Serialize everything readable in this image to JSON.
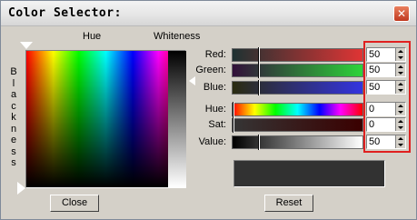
{
  "window": {
    "title": "Color Selector:",
    "close_glyph": "✕"
  },
  "headers": {
    "hue": "Hue",
    "whiteness": "Whiteness",
    "blackness": "Blackness"
  },
  "sliders": [
    {
      "label": "Red:",
      "value": "50",
      "level": 0.196,
      "colors": [
        "#1e3232",
        "#e03434"
      ]
    },
    {
      "label": "Green:",
      "value": "50",
      "level": 0.196,
      "colors": [
        "#32103a",
        "#2ed43a"
      ]
    },
    {
      "label": "Blue:",
      "value": "50",
      "level": 0.196,
      "colors": [
        "#2a2c10",
        "#3434e0"
      ]
    },
    {
      "label": "Hue:",
      "value": "0",
      "level": 0.0,
      "colors": [
        "spectrum"
      ]
    },
    {
      "label": "Sat:",
      "value": "0",
      "level": 0.0,
      "colors": [
        "#353535",
        "#3a0000"
      ]
    },
    {
      "label": "Value:",
      "value": "50",
      "level": 0.196,
      "colors": [
        "#000000",
        "#ffffff"
      ]
    }
  ],
  "preview_color": "#323232",
  "buttons": {
    "close": "Close",
    "reset": "Reset"
  },
  "highlight_color": "#e02020"
}
